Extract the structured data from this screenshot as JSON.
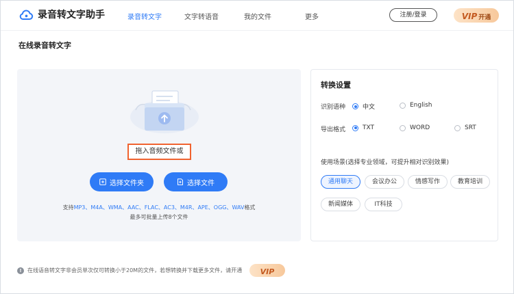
{
  "header": {
    "app_title": "录音转文字助手",
    "nav": [
      "录音转文字",
      "文字转语音",
      "我的文件",
      "更多"
    ],
    "active_nav": 0,
    "login_label": "注册/登录",
    "vip_word": "VIP",
    "vip_sub": "开通"
  },
  "page_title": "在线录音转文字",
  "upload": {
    "drop_text": "拖入音频文件或",
    "select_folder_label": "选择文件夹",
    "select_file_label": "选择文件",
    "formats_prefix": "支持",
    "formats": "MP3、M4A、WMA、AAC、FLAC、AC3、M4R、APE、OGG、WAV",
    "formats_suffix": "格式",
    "limit_text": "最多可批量上传8个文件"
  },
  "settings": {
    "title": "转换设置",
    "language_label": "识别语种",
    "language_options": [
      "中文",
      "English"
    ],
    "language_selected": "中文",
    "format_label": "导出格式",
    "format_options": [
      "TXT",
      "WORD",
      "SRT"
    ],
    "format_selected": "TXT",
    "scene_label": "使用场景(选择专业领域，可提升相对识别效果)",
    "scenes": [
      "通用聊天",
      "会议办公",
      "情感写作",
      "教育培训",
      "新闻媒体",
      "IT科技"
    ],
    "scene_selected": "通用聊天"
  },
  "footer": {
    "note": "在线语音转文字非会员单次仅可转换小于20M的文件，若想转换并下载更多文件，请开通",
    "vip_word": "VIP"
  },
  "colors": {
    "accent": "#2f7bf6",
    "highlight_border": "#f0622f",
    "vip_text": "#c45a20"
  }
}
